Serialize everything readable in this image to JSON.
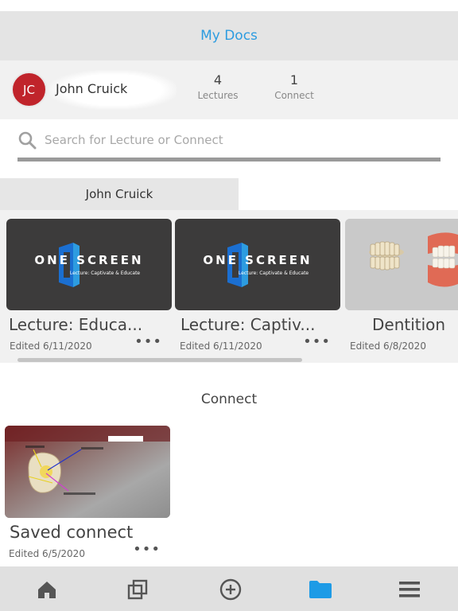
{
  "header": {
    "title": "My Docs"
  },
  "profile": {
    "initials": "JC",
    "name": "John Cruick",
    "stats": [
      {
        "value": "4",
        "label": "Lectures"
      },
      {
        "value": "1",
        "label": "Connect"
      }
    ]
  },
  "search": {
    "placeholder": "Search for Lecture or Connect",
    "value": ""
  },
  "lectures_tab": {
    "label": "John Cruick"
  },
  "lectures": [
    {
      "title": "Lecture: Educa...",
      "date": "Edited 6/11/2020",
      "thumb_text": "ONE SCREEN",
      "thumb_subtext": "Lecture: Captivate & Educate"
    },
    {
      "title": "Lecture: Captiv...",
      "date": "Edited 6/11/2020",
      "thumb_text": "ONE SCREEN",
      "thumb_subtext": "Lecture: Captivate & Educate"
    },
    {
      "title": "Dentition",
      "date": "Edited 6/8/2020"
    }
  ],
  "connect_section": {
    "heading": "Connect",
    "items": [
      {
        "title": "Saved connect",
        "date": "Edited 6/5/2020"
      }
    ]
  },
  "more_icon": "•••",
  "colors": {
    "accent": "#2d9ce0",
    "avatar": "#c0242b",
    "active_nav": "#1e9be6",
    "nav_icon": "#555555"
  },
  "bottom_nav": [
    {
      "icon": "home-icon",
      "active": false
    },
    {
      "icon": "copy-icon",
      "active": false
    },
    {
      "icon": "add-circle-icon",
      "active": false
    },
    {
      "icon": "folder-icon",
      "active": true
    },
    {
      "icon": "menu-icon",
      "active": false
    }
  ]
}
